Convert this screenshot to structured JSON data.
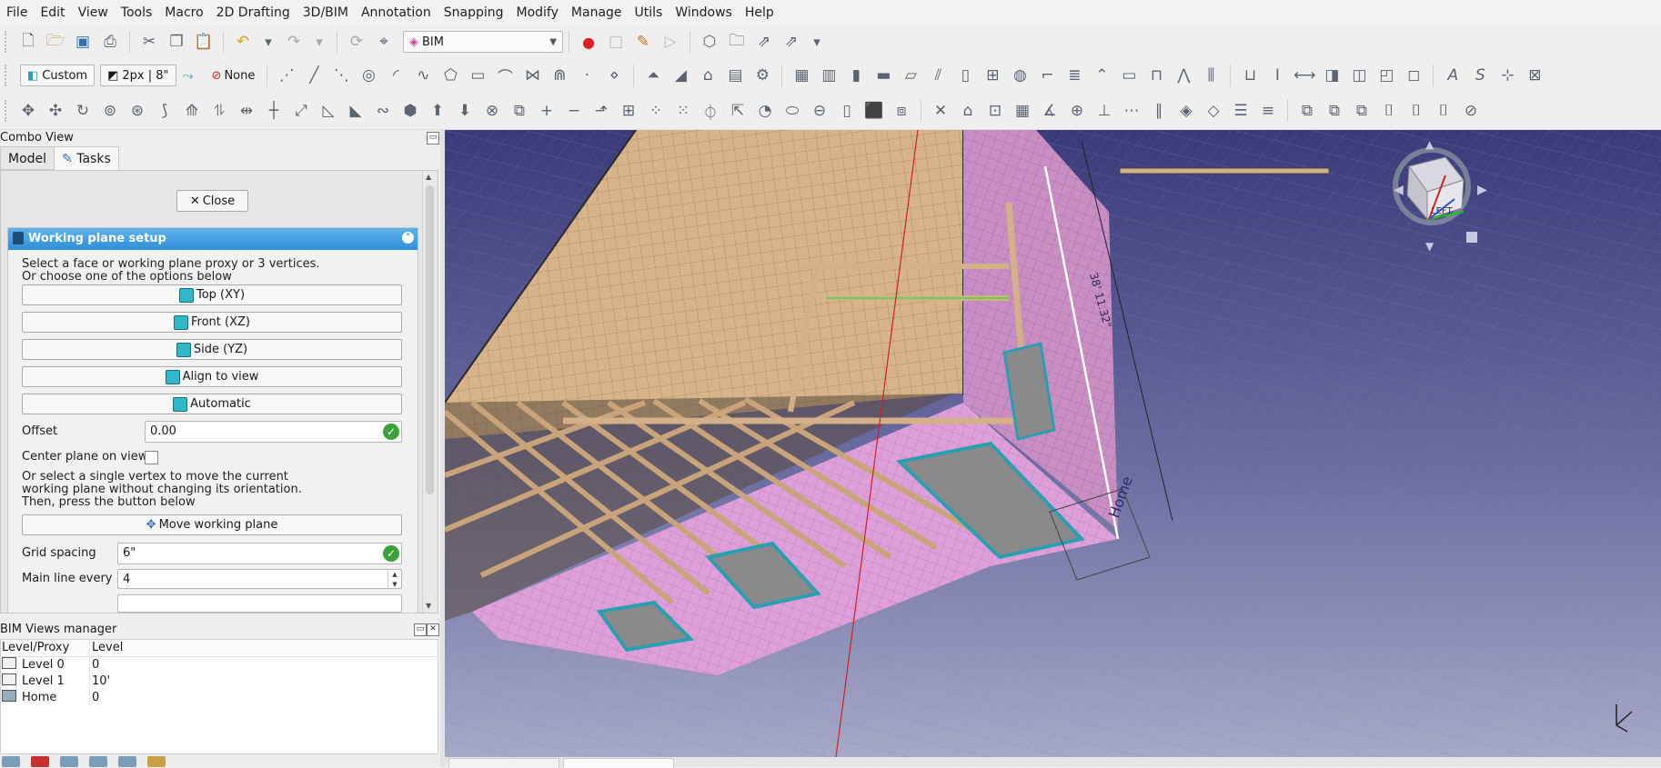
{
  "menu": [
    "File",
    "Edit",
    "View",
    "Tools",
    "Macro",
    "2D Drafting",
    "3D/BIM",
    "Annotation",
    "Snapping",
    "Modify",
    "Manage",
    "Utils",
    "Windows",
    "Help"
  ],
  "toolbar": {
    "workbench": "BIM",
    "style_label": "Custom",
    "line_label": "2px | 8\"",
    "snap_label": "None"
  },
  "combo": {
    "title": "Combo View",
    "tabs": [
      "Model",
      "Tasks"
    ]
  },
  "task": {
    "close_label": "Close",
    "panel_title": "Working plane setup",
    "instruction_1": "Select a face or working plane proxy or 3 vertices.",
    "instruction_2": "Or choose one of the options below",
    "buttons": [
      "Top (XY)",
      "Front (XZ)",
      "Side (YZ)",
      "Align to view",
      "Automatic"
    ],
    "offset_label": "Offset",
    "offset_value": "0.00",
    "center_label": "Center plane on view",
    "vertex_1": "Or select a single vertex to move the current",
    "vertex_2": "working plane without changing its orientation.",
    "vertex_3": "Then, press the button below",
    "move_label": "Move working plane",
    "grid_label": "Grid spacing",
    "grid_value": "6\"",
    "mainline_label": "Main line every",
    "mainline_value": "4"
  },
  "views_manager": {
    "title": "BIM Views manager",
    "columns": [
      "Level/Proxy",
      "Level"
    ],
    "rows": [
      {
        "name": "Level 0",
        "level": "0"
      },
      {
        "name": "Level 1",
        "level": "10'"
      },
      {
        "name": "Home",
        "level": "0"
      }
    ]
  },
  "viewport": {
    "dimension_text": "38' 11.32\"",
    "home_label": "Home",
    "nav_cube_face": "LEFT",
    "colors": {
      "sky_top": "#3a3a78",
      "sky_bottom": "#9fa2c4",
      "wall": "#d9a3d4",
      "floor": "#d4b088",
      "accent": "#2a9fb2"
    }
  }
}
